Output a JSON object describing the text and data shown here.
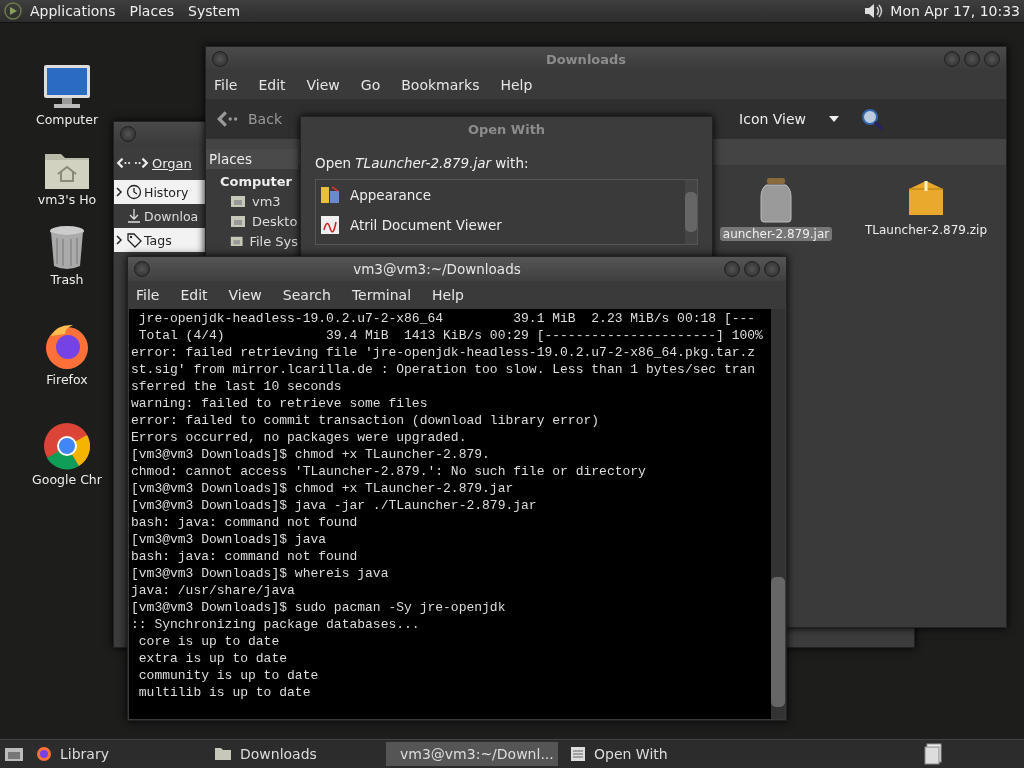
{
  "top_panel": {
    "menus": [
      "Applications",
      "Places",
      "System"
    ],
    "clock": "Mon Apr 17, 10:33"
  },
  "desktop_icons": [
    {
      "label": "Computer",
      "kind": "computer"
    },
    {
      "label": "vm3's Ho",
      "kind": "home"
    },
    {
      "label": "Trash",
      "kind": "trash"
    },
    {
      "label": "Firefox",
      "kind": "firefox"
    },
    {
      "label": "Google Chr",
      "kind": "chrome"
    }
  ],
  "file_manager": {
    "title": "Downloads",
    "menu": [
      "File",
      "Edit",
      "View",
      "Go",
      "Bookmarks",
      "Help"
    ],
    "back": "Back",
    "view_mode": "Icon View",
    "places_header": "Places",
    "section": "Computer",
    "places": [
      "vm3",
      "Deskto",
      "File Sys"
    ],
    "files": [
      {
        "name": "auncher-2.879.jar",
        "kind": "jar",
        "selected": true
      },
      {
        "name": "TLauncher-2.879.zip",
        "kind": "zip",
        "selected": false
      }
    ]
  },
  "library": {
    "organize": "Organ",
    "items": [
      {
        "label": "History",
        "kind": "history",
        "expandable": true,
        "selected": false
      },
      {
        "label": "Downloa",
        "kind": "downloads",
        "expandable": false,
        "selected": true
      },
      {
        "label": "Tags",
        "kind": "tags",
        "expandable": true,
        "selected": false
      }
    ]
  },
  "open_with": {
    "title": "Open With",
    "prompt": "Open *TLauncher-2.879.jar* with:",
    "apps": [
      {
        "name": "Appearance",
        "kind": "appearance"
      },
      {
        "name": "Atril Document Viewer",
        "kind": "atril"
      }
    ]
  },
  "terminal": {
    "title": "vm3@vm3:~/Downloads",
    "menu": [
      "File",
      "Edit",
      "View",
      "Search",
      "Terminal",
      "Help"
    ],
    "lines": [
      " jre-openjdk-headless-19.0.2.u7-2-x86_64         39.1 MiB  2.23 MiB/s 00:18 [---",
      " Total (4/4)             39.4 MiB  1413 KiB/s 00:29 [----------------------] 100%",
      "error: failed retrieving file 'jre-openjdk-headless-19.0.2.u7-2-x86_64.pkg.tar.z",
      "st.sig' from mirror.lcarilla.de : Operation too slow. Less than 1 bytes/sec tran",
      "sferred the last 10 seconds",
      "warning: failed to retrieve some files",
      "error: failed to commit transaction (download library error)",
      "Errors occurred, no packages were upgraded.",
      "[vm3@vm3 Downloads]$ chmod +x TLauncher-2.879.",
      "chmod: cannot access 'TLauncher-2.879.': No such file or directory",
      "[vm3@vm3 Downloads]$ chmod +x TLauncher-2.879.jar",
      "[vm3@vm3 Downloads]$ java -jar ./TLauncher-2.879.jar",
      "bash: java: command not found",
      "[vm3@vm3 Downloads]$ java",
      "bash: java: command not found",
      "[vm3@vm3 Downloads]$ whereis java",
      "java: /usr/share/java",
      "[vm3@vm3 Downloads]$ sudo pacman -Sy jre-openjdk",
      ":: Synchronizing package databases...",
      " core is up to date",
      " extra is up to date",
      " community is up to date",
      " multilib is up to date"
    ]
  },
  "taskbar": {
    "items": [
      {
        "label": "Library",
        "kind": "firefox",
        "active": false
      },
      {
        "label": "Downloads",
        "kind": "folder",
        "active": false
      },
      {
        "label": "vm3@vm3:~/Downl...",
        "kind": "terminal",
        "active": true
      },
      {
        "label": "Open With",
        "kind": "dialog",
        "active": false
      }
    ]
  }
}
